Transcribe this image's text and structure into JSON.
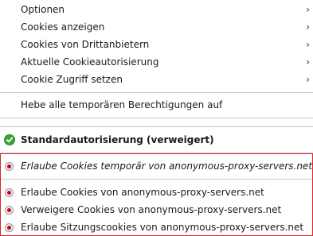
{
  "menu": {
    "submenus": [
      {
        "label": "Optionen"
      },
      {
        "label": "Cookies anzeigen"
      },
      {
        "label": "Cookies von Drittanbietern"
      },
      {
        "label": "Aktuelle Cookieautorisierung"
      },
      {
        "label": "Cookie Zugriff setzen"
      }
    ],
    "revoke_temp": "Hebe alle temporären Berechtigungen auf",
    "default_auth": "Standardautorisierung (verweigert)",
    "allow_temp": "Erlaube Cookies temporär von anonymous-proxy-servers.net",
    "allow": "Erlaube Cookies von anonymous-proxy-servers.net",
    "deny": "Verweigere Cookies von anonymous-proxy-servers.net",
    "allow_session": "Erlaube Sitzungscookies von anonymous-proxy-servers.net",
    "submenu_arrow": "›",
    "icons": {
      "default_icon": "check-circle-icon",
      "radio_icon": "radio-red-dot-icon"
    },
    "colors": {
      "highlight_border": "#d9262d",
      "radio_dot": "#d0021b",
      "check_green": "#3aa63a"
    }
  }
}
